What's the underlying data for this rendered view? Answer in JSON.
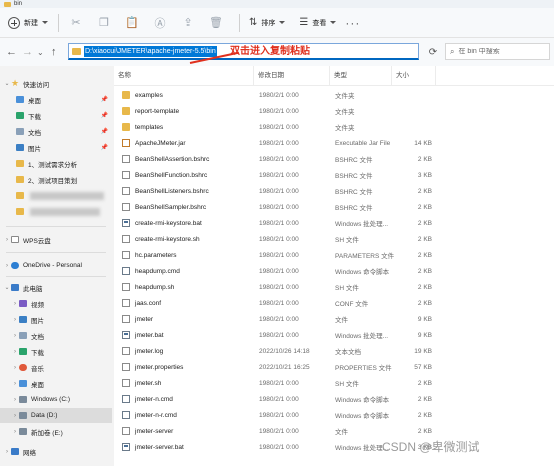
{
  "window": {
    "title": "bin"
  },
  "toolbar": {
    "new_label": "新建",
    "sort_label": "排序",
    "view_label": "查看",
    "more_label": "···"
  },
  "address": {
    "path": "D:\\xiaocui\\JMETER\\apache-jmeter-5.5\\bin",
    "annotation": "双击进入复制粘贴",
    "search_placeholder": "在 bin 中搜索"
  },
  "sidebar": {
    "quick_access": "快速访问",
    "quick_items": [
      {
        "label": "桌面",
        "icon": "desktop-icon"
      },
      {
        "label": "下载",
        "icon": "download-icon"
      },
      {
        "label": "文档",
        "icon": "document-icon"
      },
      {
        "label": "图片",
        "icon": "picture-icon"
      },
      {
        "label": "1、测试需求分析",
        "icon": "folder-icon"
      },
      {
        "label": "2、测试项目策划",
        "icon": "folder-icon"
      }
    ],
    "wps": "WPS云盘",
    "onedrive": "OneDrive - Personal",
    "this_pc": "此电脑",
    "pc_items": [
      {
        "label": "视频",
        "icon": "video-icon"
      },
      {
        "label": "图片",
        "icon": "picture-icon"
      },
      {
        "label": "文档",
        "icon": "document-icon"
      },
      {
        "label": "下载",
        "icon": "download-icon"
      },
      {
        "label": "音乐",
        "icon": "music-icon"
      },
      {
        "label": "桌面",
        "icon": "desktop-icon"
      },
      {
        "label": "Windows (C:)",
        "icon": "drive-icon"
      },
      {
        "label": "Data (D:)",
        "icon": "drive-icon"
      },
      {
        "label": "新加卷 (E:)",
        "icon": "drive-icon"
      }
    ],
    "network": "网络"
  },
  "columns": {
    "name": "名称",
    "date": "修改日期",
    "type": "类型",
    "size": "大小"
  },
  "files": [
    {
      "name": "examples",
      "date": "1980/2/1 0:00",
      "type": "文件夹",
      "size": "",
      "kind": "folder"
    },
    {
      "name": "report-template",
      "date": "1980/2/1 0:00",
      "type": "文件夹",
      "size": "",
      "kind": "folder"
    },
    {
      "name": "templates",
      "date": "1980/2/1 0:00",
      "type": "文件夹",
      "size": "",
      "kind": "folder"
    },
    {
      "name": "ApacheJMeter.jar",
      "date": "1980/2/1 0:00",
      "type": "Executable Jar File",
      "size": "14 KB",
      "kind": "jar"
    },
    {
      "name": "BeanShellAssertion.bshrc",
      "date": "1980/2/1 0:00",
      "type": "BSHRC 文件",
      "size": "2 KB",
      "kind": "doc"
    },
    {
      "name": "BeanShellFunction.bshrc",
      "date": "1980/2/1 0:00",
      "type": "BSHRC 文件",
      "size": "3 KB",
      "kind": "doc"
    },
    {
      "name": "BeanShellListeners.bshrc",
      "date": "1980/2/1 0:00",
      "type": "BSHRC 文件",
      "size": "2 KB",
      "kind": "doc"
    },
    {
      "name": "BeanShellSampler.bshrc",
      "date": "1980/2/1 0:00",
      "type": "BSHRC 文件",
      "size": "2 KB",
      "kind": "doc"
    },
    {
      "name": "create-rmi-keystore.bat",
      "date": "1980/2/1 0:00",
      "type": "Windows 批处理...",
      "size": "2 KB",
      "kind": "bat"
    },
    {
      "name": "create-rmi-keystore.sh",
      "date": "1980/2/1 0:00",
      "type": "SH 文件",
      "size": "2 KB",
      "kind": "doc"
    },
    {
      "name": "hc.parameters",
      "date": "1980/2/1 0:00",
      "type": "PARAMETERS 文件",
      "size": "2 KB",
      "kind": "doc"
    },
    {
      "name": "heapdump.cmd",
      "date": "1980/2/1 0:00",
      "type": "Windows 命令脚本",
      "size": "2 KB",
      "kind": "cmd"
    },
    {
      "name": "heapdump.sh",
      "date": "1980/2/1 0:00",
      "type": "SH 文件",
      "size": "2 KB",
      "kind": "doc"
    },
    {
      "name": "jaas.conf",
      "date": "1980/2/1 0:00",
      "type": "CONF 文件",
      "size": "2 KB",
      "kind": "doc"
    },
    {
      "name": "jmeter",
      "date": "1980/2/1 0:00",
      "type": "文件",
      "size": "9 KB",
      "kind": "doc"
    },
    {
      "name": "jmeter.bat",
      "date": "1980/2/1 0:00",
      "type": "Windows 批处理...",
      "size": "9 KB",
      "kind": "bat"
    },
    {
      "name": "jmeter.log",
      "date": "2022/10/26 14:18",
      "type": "文本文档",
      "size": "19 KB",
      "kind": "doc"
    },
    {
      "name": "jmeter.properties",
      "date": "2022/10/21 16:25",
      "type": "PROPERTIES 文件",
      "size": "57 KB",
      "kind": "doc"
    },
    {
      "name": "jmeter.sh",
      "date": "1980/2/1 0:00",
      "type": "SH 文件",
      "size": "2 KB",
      "kind": "doc"
    },
    {
      "name": "jmeter-n.cmd",
      "date": "1980/2/1 0:00",
      "type": "Windows 命令脚本",
      "size": "2 KB",
      "kind": "cmd"
    },
    {
      "name": "jmeter-n-r.cmd",
      "date": "1980/2/1 0:00",
      "type": "Windows 命令脚本",
      "size": "2 KB",
      "kind": "cmd"
    },
    {
      "name": "jmeter-server",
      "date": "1980/2/1 0:00",
      "type": "文件",
      "size": "2 KB",
      "kind": "doc"
    },
    {
      "name": "jmeter-server.bat",
      "date": "1980/2/1 0:00",
      "type": "Windows 批处理...",
      "size": "3 KB",
      "kind": "bat"
    }
  ],
  "watermark": "CSDN @卑微测试"
}
